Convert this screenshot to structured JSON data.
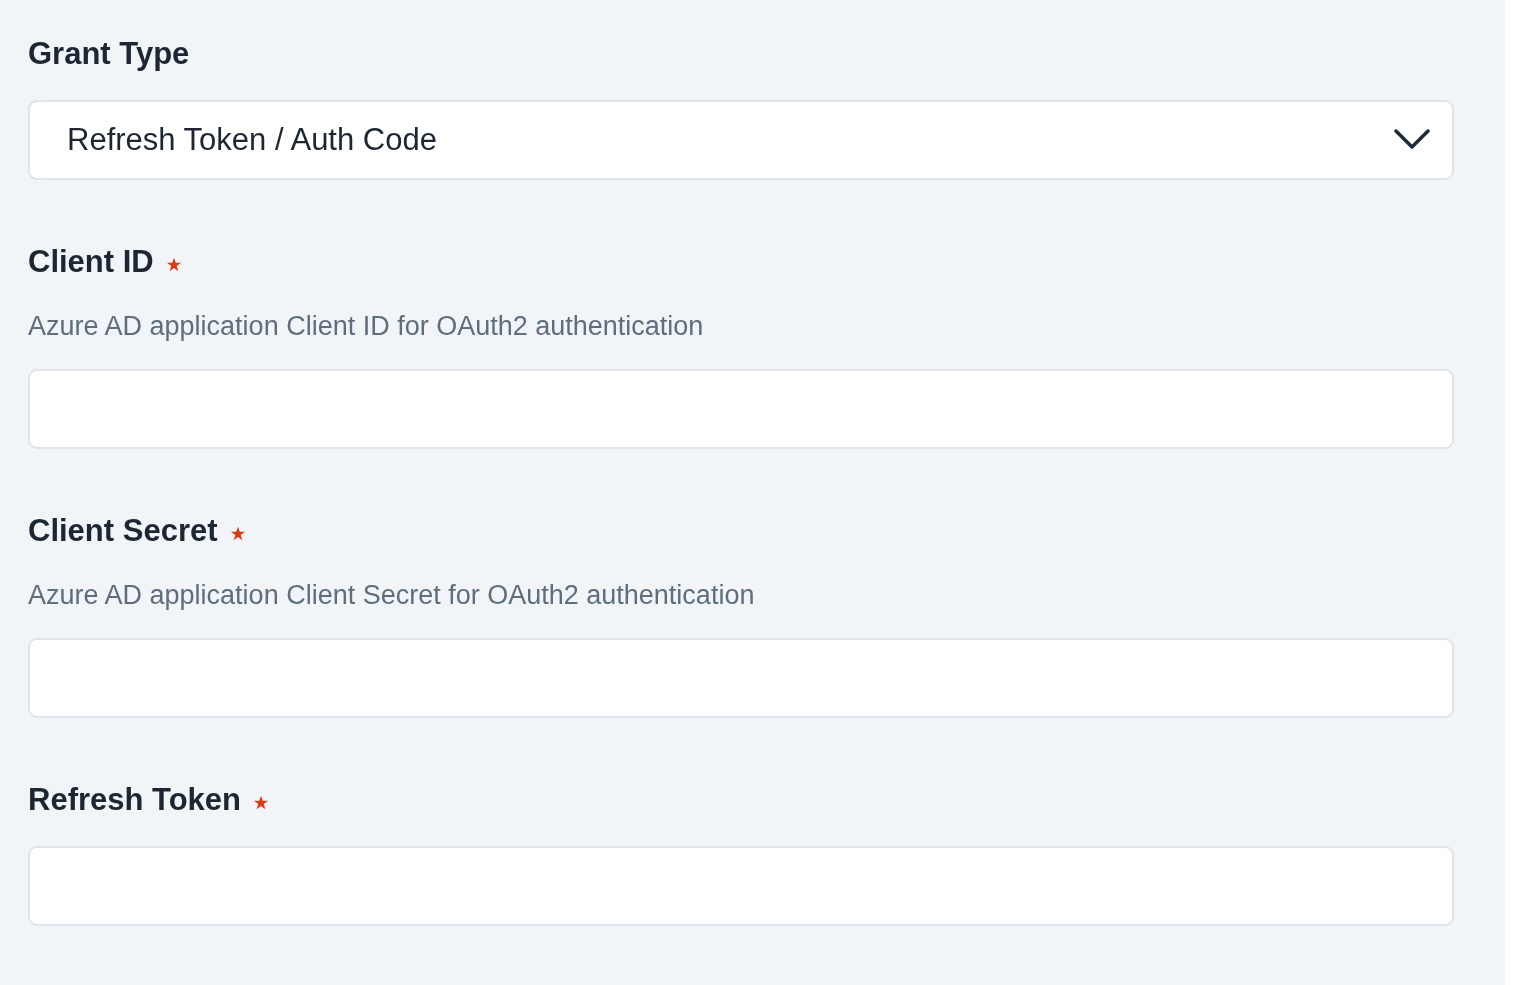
{
  "fields": [
    {
      "kind": "select",
      "label": "Grant Type",
      "required": false,
      "value": "Refresh Token / Auth Code"
    },
    {
      "kind": "text",
      "label": "Client ID",
      "required": true,
      "description": "Azure AD application Client ID for OAuth2 authentication"
    },
    {
      "kind": "text",
      "label": "Client Secret",
      "required": true,
      "description": "Azure AD application Client Secret for OAuth2 authentication"
    },
    {
      "kind": "text",
      "label": "Refresh Token",
      "required": true
    }
  ]
}
